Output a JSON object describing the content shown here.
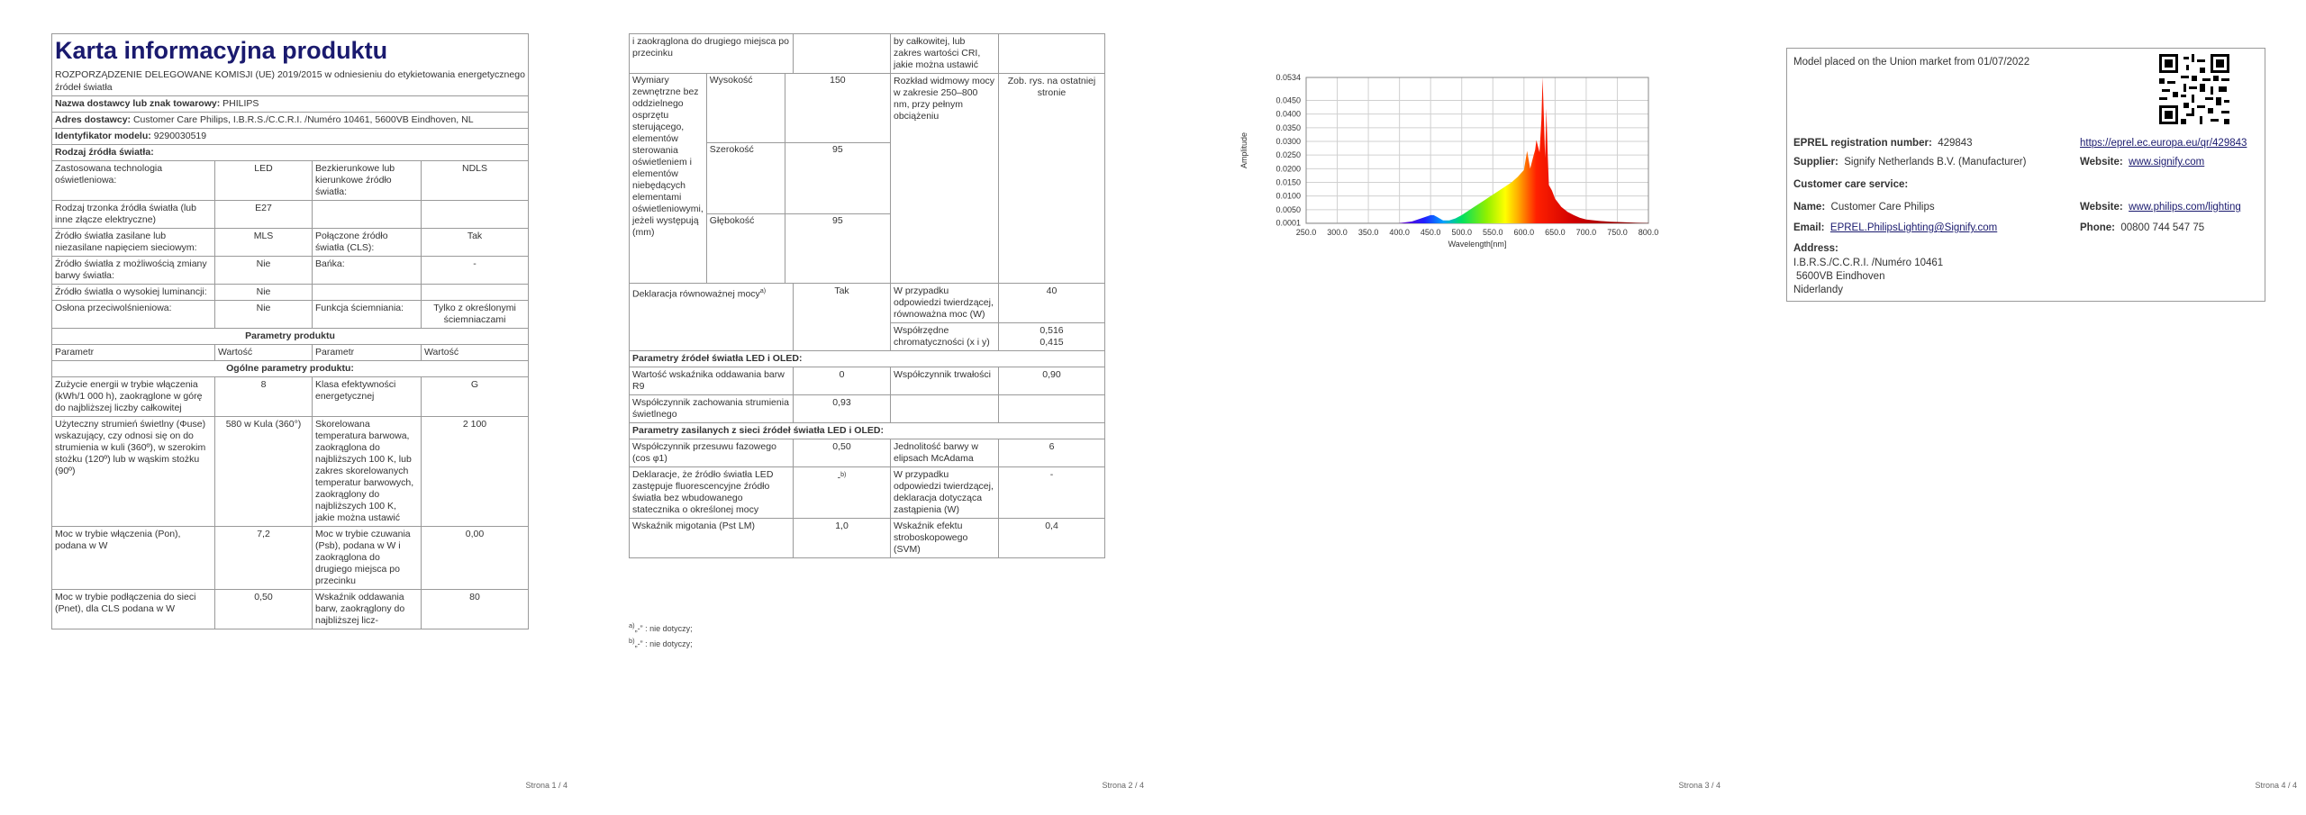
{
  "colors": {
    "title": "#1a1a6e",
    "border": "#9a9a9a",
    "link": "#1a1a6e"
  },
  "page1": {
    "title": "Karta informacyjna produktu",
    "subtitle": "ROZPORZĄDZENIE DELEGOWANE KOMISJI (UE) 2019/2015 w odniesieniu do etykietowania energetycznego źródeł światła",
    "supplier_label": "Nazwa dostawcy lub znak towarowy:",
    "supplier_value": "PHILIPS",
    "address_label": "Adres dostawcy:",
    "address_value": "Customer Care Philips, I.B.R.S./C.C.R.I. /Numéro 10461, 5600VB Eindhoven, NL",
    "model_label": "Identyfikator modelu:",
    "model_value": "9290030519",
    "source_type": "Rodzaj źródła światła:",
    "r1": [
      "Zastosowana technologia oświetleniowa:",
      "LED",
      "Bezkierunkowe lub kierunkowe źródło światła:",
      "NDLS"
    ],
    "r2": [
      "Rodzaj trzonka źródła światła (lub inne złącze elektryczne)",
      "E27",
      "",
      ""
    ],
    "r3": [
      "Źródło światła zasilane lub niezasilane napięciem sieciowym:",
      "MLS",
      "Połączone źródło światła (CLS):",
      "Tak"
    ],
    "r4": [
      "Źródło światła z możliwością zmiany barwy światła:",
      "Nie",
      "Bańka:",
      "-"
    ],
    "r5": [
      "Źródło światła o wysokiej luminancji:",
      "Nie",
      "",
      ""
    ],
    "r6": [
      "Osłona przeciwolśnieniowa:",
      "Nie",
      "Funkcja ściemniania:",
      "Tylko z określonymi ściemniaczami"
    ],
    "params_header": "Parametry produktu",
    "col_headers": [
      "Parametr",
      "Wartość",
      "Parametr",
      "Wartość"
    ],
    "general_header": "Ogólne parametry produktu:",
    "g1": [
      "Zużycie energii w trybie włączenia (kWh/1 000 h), zaokrąglone w górę do najbliższej liczby całkowitej",
      "8",
      "Klasa efektywności energetycznej",
      "G"
    ],
    "g2": [
      "Użyteczny strumień świetlny (Φuse) wskazujący, czy odnosi się on do strumienia w kuli (360º), w szerokim stożku (120º) lub w wąskim stożku (90º)",
      "580 w Kula (360°)",
      "Skorelowana temperatura barwowa, zaokrąglona do najbliższych 100 K, lub zakres skorelowanych temperatur barwowych, zaokrąglony do najbliższych 100 K, jakie można ustawić",
      "2 100"
    ],
    "g3": [
      "Moc w trybie włączenia (Pon), podana w W",
      "7,2",
      "Moc w trybie czuwania (Psb), podana w W i zaokrąglona do drugiego miejsca po przecinku",
      "0,00"
    ],
    "g4": [
      "Moc w trybie podłączenia do sieci (Pnet), dla CLS podana w W",
      "0,50",
      "Wskaźnik oddawania barw, zaokrąglony do najbliższej licz-",
      "80"
    ],
    "page_num": "Strona 1 / 4"
  },
  "page2": {
    "top_left": "i zaokrąglona do drugiego miejsca po przecinku",
    "top_right": "by całkowitej, lub zakres wartości CRI, jakie można ustawić",
    "dims_label": "Wymiary zewnętrzne bez oddzielnego osprzętu sterującego, elementów sterowania oświetleniem i elementów niebędących elementami oświetleniowymi, jeżeli występują (mm)",
    "dims": [
      {
        "name": "Wysokość",
        "value": "150"
      },
      {
        "name": "Szerokość",
        "value": "95"
      },
      {
        "name": "Głębokość",
        "value": "95"
      }
    ],
    "spectral_label": "Rozkład widmowy mocy w zakresie 250–800 nm, przy pełnym obciążeniu",
    "spectral_value": "Zob. rys. na ostatniej stronie",
    "equiv_label": "Deklaracja równoważnej mocy",
    "equiv_sup": "a)",
    "equiv_value": "Tak",
    "equiv_power_label": "W przypadku odpowiedzi twierdzącej, równoważna moc (W)",
    "equiv_power_value": "40",
    "chroma_label": "Współrzędne chromatyczności (x i y)",
    "chroma_x": "0,516",
    "chroma_y": "0,415",
    "led_header": "Parametry źródeł światła LED i OLED:",
    "r9_label": "Wartość wskaźnika oddawania barw R9",
    "r9_value": "0",
    "surv_label": "Współczynnik trwałości",
    "surv_value": "0,90",
    "lumen_label": "Współczynnik zachowania strumienia świetlnego",
    "lumen_value": "0,93",
    "mains_header": "Parametry zasilanych z sieci źródeł światła LED i OLED:",
    "cos_label": "Współczynnik przesuwu fazowego (cos φ1)",
    "cos_value": "0,50",
    "mcadam_label": "Jednolitość barwy w elipsach McAdama",
    "mcadam_value": "6",
    "fluor_label": "Deklaracje, że źródło światła LED zastępuje fluorescencyjne źródło światła bez wbudowanego statecznika o określonej mocy",
    "fluor_value": "-",
    "fluor_sup": "b)",
    "fluor_repl_label": "W przypadku odpowiedzi twierdzącej, deklaracja dotycząca zastąpienia (W)",
    "fluor_repl_value": "-",
    "flicker_label": "Wskaźnik migotania (Pst LM)",
    "flicker_value": "1,0",
    "svm_label": "Wskaźnik efektu stroboskopowego (SVM)",
    "svm_value": "0,4",
    "foot_a_mark": "a)",
    "foot_a": "„-” : nie dotyczy;",
    "foot_b_mark": "b)",
    "foot_b": "„-” : nie dotyczy;",
    "page_num": "Strona 2 / 4"
  },
  "page3": {
    "page_num": "Strona 3 / 4",
    "chart_data": {
      "type": "area",
      "xlabel": "Wavelength[nm]",
      "ylabel": "Amplitude",
      "xlim": [
        250,
        800
      ],
      "ylim": [
        0.0001,
        0.0534
      ],
      "x_ticks": [
        "250.0",
        "300.0",
        "350.0",
        "400.0",
        "450.0",
        "500.0",
        "550.0",
        "600.0",
        "650.0",
        "700.0",
        "750.0",
        "800.0"
      ],
      "y_ticks": [
        "0.0001",
        "0.0050",
        "0.0100",
        "0.0150",
        "0.0200",
        "0.0250",
        "0.0300",
        "0.0350",
        "0.0400",
        "0.0450",
        "0.0534"
      ],
      "grid": true,
      "x": [
        400,
        420,
        440,
        450,
        455,
        460,
        470,
        480,
        490,
        500,
        520,
        540,
        560,
        580,
        590,
        600,
        605,
        610,
        615,
        618,
        620,
        625,
        628,
        630,
        632,
        634,
        636,
        638,
        640,
        645,
        650,
        660,
        670,
        680,
        690,
        700,
        720,
        740,
        760,
        780,
        800
      ],
      "y": [
        0.0001,
        0.0007,
        0.0022,
        0.003,
        0.003,
        0.0024,
        0.0011,
        0.0011,
        0.0018,
        0.003,
        0.006,
        0.009,
        0.012,
        0.015,
        0.017,
        0.0195,
        0.0265,
        0.02,
        0.0245,
        0.027,
        0.0305,
        0.026,
        0.038,
        0.0534,
        0.039,
        0.024,
        0.042,
        0.026,
        0.014,
        0.012,
        0.009,
        0.006,
        0.0042,
        0.003,
        0.002,
        0.0014,
        0.0009,
        0.0006,
        0.0004,
        0.0002,
        0.0001
      ]
    }
  },
  "page4": {
    "placed": "Model placed on the Union market from 01/07/2022",
    "eprel_label": "EPREL registration number:",
    "eprel_value": "429843",
    "eprel_link": "https://eprel.ec.europa.eu/qr/429843",
    "supplier_label": "Supplier:",
    "supplier_value": "Signify Netherlands B.V. (Manufacturer)",
    "website_label": "Website:",
    "website_value": "www.signify.com",
    "care_header": "Customer care service:",
    "name_label": "Name:",
    "name_value": "Customer Care Philips",
    "website2_label": "Website:",
    "website2_value": "www.philips.com/lighting",
    "email_label": "Email:",
    "email_value": "EPREL.PhilipsLighting@Signify.com",
    "phone_label": "Phone:",
    "phone_value": "00800 744 547 75",
    "address_label": "Address:",
    "address_lines": [
      "I.B.R.S./C.C.R.I. /Numéro 10461",
      "5600VB Eindhoven",
      "Niderlandy"
    ],
    "page_num": "Strona 4 / 4"
  }
}
